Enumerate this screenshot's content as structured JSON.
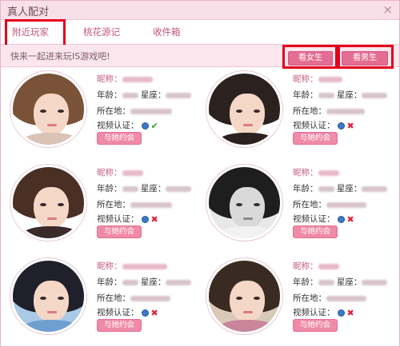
{
  "window": {
    "title": "真人配对",
    "close_glyph": "×"
  },
  "tabs": [
    {
      "label": "附近玩家",
      "active": true
    },
    {
      "label": "桃花源记",
      "active": false
    },
    {
      "label": "收件箱",
      "active": false
    }
  ],
  "banner": {
    "text": "快来一起进来玩IS游戏吧!"
  },
  "filters": {
    "female_label": "看女生",
    "male_label": "看男生"
  },
  "field_labels": {
    "nickname": "昵称：",
    "age": "年龄：",
    "zodiac": "星座：",
    "location": "所在地：",
    "video": "视频认证："
  },
  "profiles": [
    {
      "date_label": "与她约会",
      "video_verified": true
    },
    {
      "date_label": "与她约会",
      "video_verified": false
    },
    {
      "date_label": "与她约会",
      "video_verified": false
    },
    {
      "date_label": "与她约会",
      "video_verified": false
    },
    {
      "date_label": "与她约会",
      "video_verified": false
    },
    {
      "date_label": "与她约会",
      "video_verified": false
    }
  ],
  "colors": {
    "accent": "#e46e93",
    "highlight_outline": "#e3001b",
    "label_pink": "#c55d84"
  }
}
